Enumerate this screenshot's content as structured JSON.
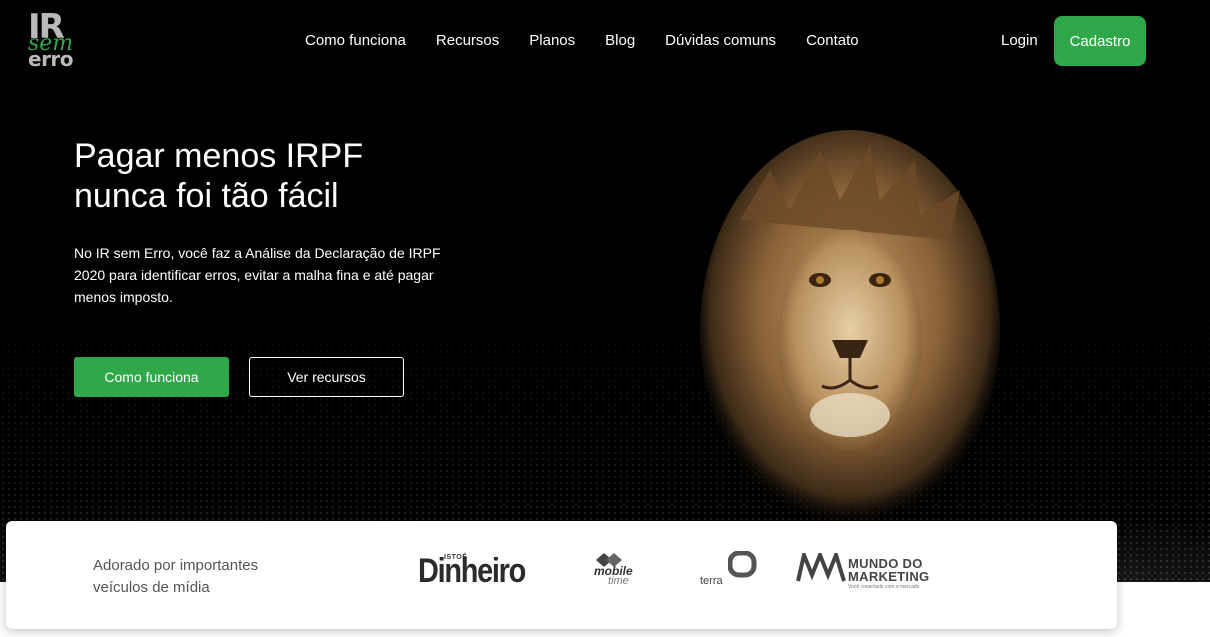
{
  "header": {
    "logo": {
      "line1": "IR",
      "line2": "sem",
      "line3": "erro"
    },
    "nav": [
      {
        "label": "Como funciona"
      },
      {
        "label": "Recursos"
      },
      {
        "label": "Planos"
      },
      {
        "label": "Blog"
      },
      {
        "label": "Dúvidas comuns"
      },
      {
        "label": "Contato"
      }
    ],
    "login_label": "Login",
    "signup_label": "Cadastro"
  },
  "hero": {
    "title_line1": "Pagar menos IRPF",
    "title_line2": "nunca foi tão fácil",
    "description": "No IR sem Erro, você faz a Análise da Declaração de IRPF 2020 para identificar erros, evitar a malha fina e até pagar menos imposto.",
    "primary_button": "Como funciona",
    "secondary_button": "Ver recursos"
  },
  "media": {
    "label_line1": "Adorado por importantes",
    "label_line2": "veículos de mídia",
    "logos": {
      "dinheiro_small": "ISTOÉ",
      "dinheiro": "Dinheiro",
      "mobile_line1": "mobile",
      "mobile_line2": "time",
      "terra": "terra",
      "mm_line1": "MUNDO DO",
      "mm_line2": "MARKETING",
      "mm_tagline": "Você conectado com o mercado"
    }
  },
  "colors": {
    "accent_green": "#2fa74a",
    "hero_background": "#000000"
  }
}
